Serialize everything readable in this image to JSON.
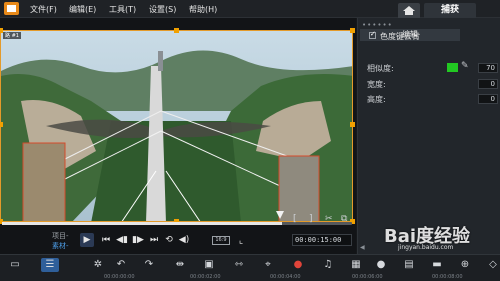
{
  "menu": {
    "items": [
      "文件(F)",
      "编辑(E)",
      "工具(T)",
      "设置(S)",
      "帮助(H)"
    ],
    "capture_tab": "捕获"
  },
  "preview": {
    "clip_label": "路 #1"
  },
  "transport": {
    "project_label": "项目-",
    "clip_mode_label": "素材-",
    "aspect_label": "16:9",
    "timecode": "00:00:15:00"
  },
  "panel": {
    "tab_label": "编辑",
    "chroma_key_label": "色度键去背",
    "similarity_label": "相似度:",
    "similarity_value": "70",
    "width_label": "宽度:",
    "width_value": "0",
    "height_label": "高度:",
    "height_value": "0",
    "key_color": "#22c822"
  },
  "timeline_ruler": [
    "00:00:00:00",
    "00:00:02:00",
    "00:00:04:00",
    "00:00:06:00",
    "00:00:08:00"
  ],
  "watermark": {
    "brand": "Bai度经验",
    "url": "jingyan.baidu.com"
  },
  "colors": {
    "accent": "#e49a2a",
    "active_tab": "#2f5f9a"
  }
}
